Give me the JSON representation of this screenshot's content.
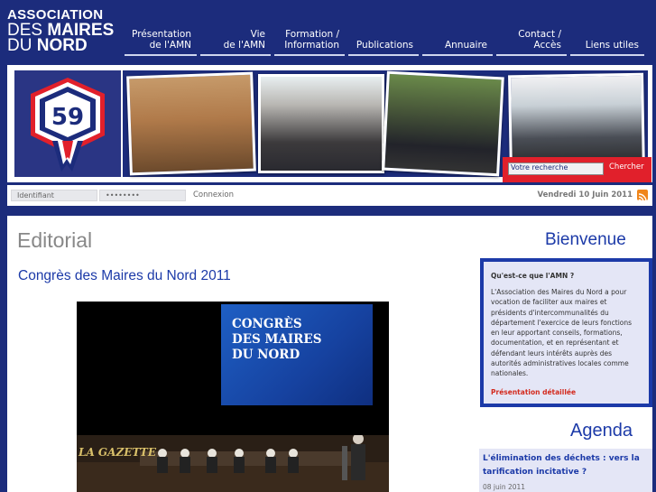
{
  "header": {
    "logo": {
      "line1": "ASSOCIATION",
      "line2_thin": "DES ",
      "line2_bold": "MAIRES",
      "line3_thin": "DU ",
      "line3_bold": "NORD"
    },
    "nav": [
      {
        "label": "Présentation\nde l'AMN"
      },
      {
        "label": "Vie\nde l'AMN"
      },
      {
        "label": "Formation /\nInformation"
      },
      {
        "label": "Publications"
      },
      {
        "label": "Annuaire"
      },
      {
        "label": "Contact /\nAccès"
      },
      {
        "label": "Liens utiles"
      }
    ]
  },
  "banner": {
    "emblem_number": "59"
  },
  "search": {
    "placeholder": "Votre recherche",
    "button": "Chercher"
  },
  "login": {
    "identifier_placeholder": "Identifiant",
    "password_placeholder": "••••••••",
    "button": "Connexion",
    "date": "Vendredi 10 Juin 2011",
    "rss_icon": "rss-icon"
  },
  "main": {
    "section_heading": "Editorial",
    "article_title": "Congrès des Maires du Nord 2011",
    "image_screen_text": "CONGRÈS\nDES MAIRES\nDU NORD",
    "image_sign_text": "LA GAZETTE"
  },
  "sidebar": {
    "welcome_heading": "Bienvenue",
    "amn_question": "Qu'est-ce que l'AMN ?",
    "amn_text": "L'Association des Maires du Nord a pour vocation de faciliter aux maires et présidents d'intercommunalités du département l'exercice de leurs fonctions en leur apportant conseils, formations, documentation, et en représentant et défendant leurs intérêts auprès des autorités administratives locales comme nationales.",
    "amn_link": "Présentation détaillée",
    "agenda_heading": "Agenda",
    "agenda_item_title": "L'élimination des déchets : vers la tarification incitative ?",
    "agenda_item_date": "08 juin 2011"
  },
  "colors": {
    "brand_blue": "#1c2c7c",
    "link_blue": "#1c3aa8",
    "accent_red": "#e1202b"
  }
}
